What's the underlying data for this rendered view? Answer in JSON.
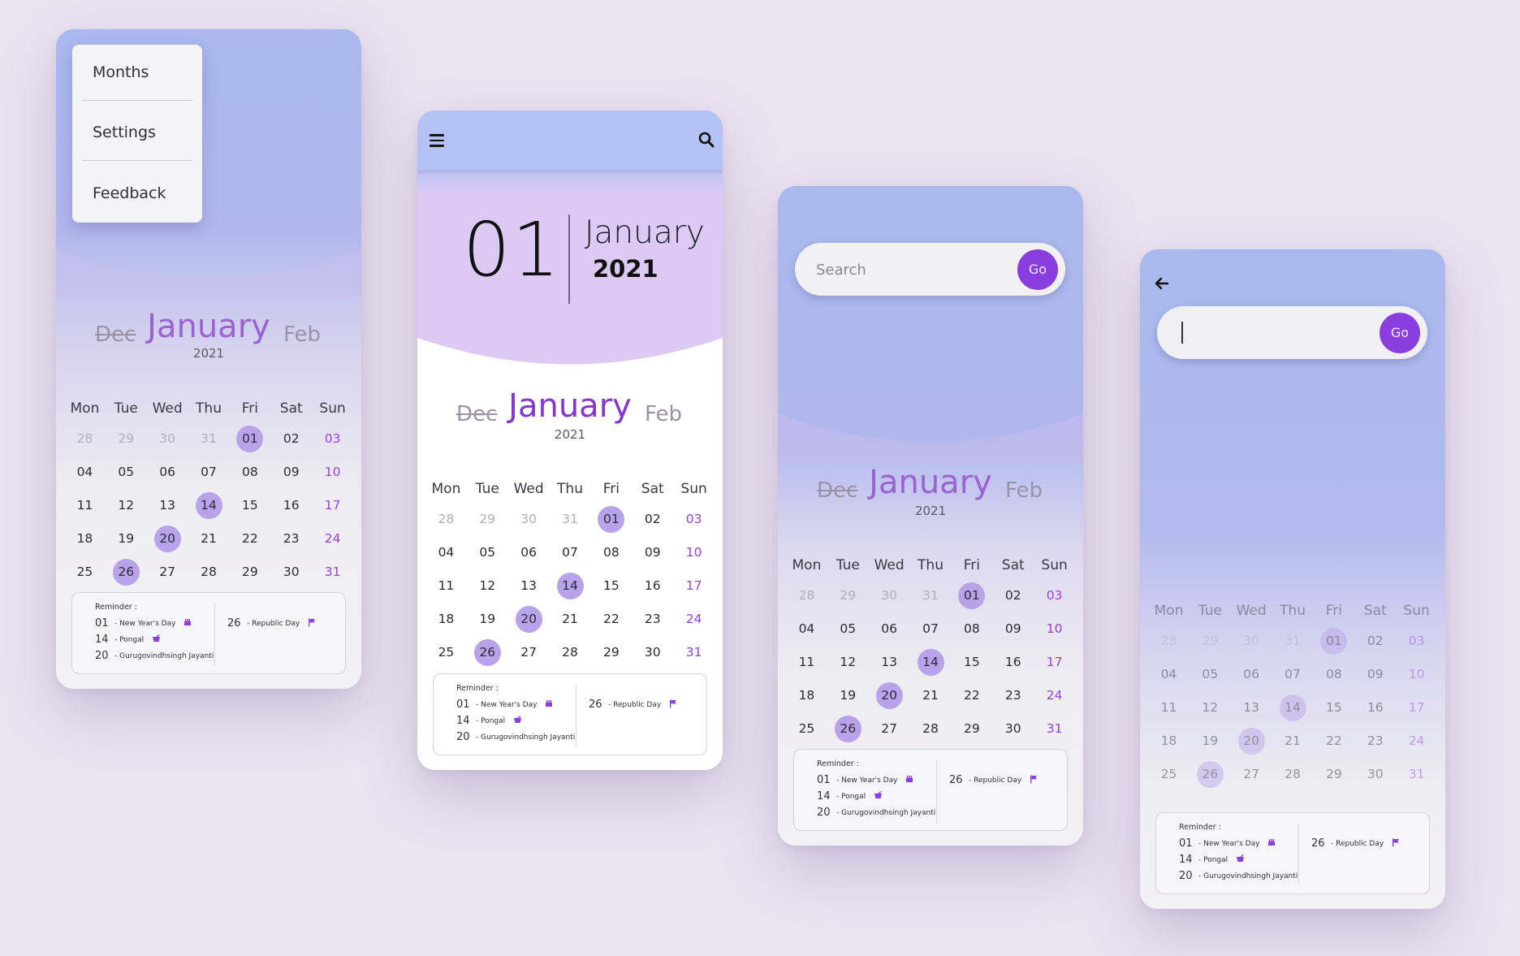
{
  "calendar": {
    "prev_month": "Dec",
    "month": "January",
    "next_month": "Feb",
    "year": "2021",
    "weekdays": [
      "Mon",
      "Tue",
      "Wed",
      "Thu",
      "Fri",
      "Sat",
      "Sun"
    ],
    "weeks": [
      [
        "28",
        "29",
        "30",
        "31",
        "01",
        "02",
        "03"
      ],
      [
        "04",
        "05",
        "06",
        "07",
        "08",
        "09",
        "10"
      ],
      [
        "11",
        "12",
        "13",
        "14",
        "15",
        "16",
        "17"
      ],
      [
        "18",
        "19",
        "20",
        "21",
        "22",
        "23",
        "24"
      ],
      [
        "25",
        "26",
        "27",
        "28",
        "29",
        "30",
        "31"
      ]
    ],
    "muted_days": [
      "28",
      "29",
      "30",
      "31"
    ],
    "highlighted_days": [
      "01",
      "14",
      "20",
      "26"
    ]
  },
  "reminder": {
    "title": "Reminder :",
    "items": [
      {
        "day": "01",
        "label": "- New Year's Day",
        "icon": "cake-icon"
      },
      {
        "day": "14",
        "label": "- Pongal",
        "icon": "pot-icon"
      },
      {
        "day": "20",
        "label": "- Gurugovindhsingh Jayanti",
        "icon": ""
      }
    ],
    "side_item": {
      "day": "26",
      "label": "- Republic Day",
      "icon": "flag-icon"
    }
  },
  "menu": {
    "items": [
      "Months",
      "Settings",
      "Feedback"
    ]
  },
  "today": {
    "day": "01",
    "month": "January",
    "year": "2021"
  },
  "search": {
    "placeholder": "Search",
    "go_label": "Go"
  },
  "colors": {
    "accent": "#8a3ee0",
    "highlight": "#b8a2ea",
    "header": "#b4c1f3",
    "background": "#ece3f1"
  }
}
